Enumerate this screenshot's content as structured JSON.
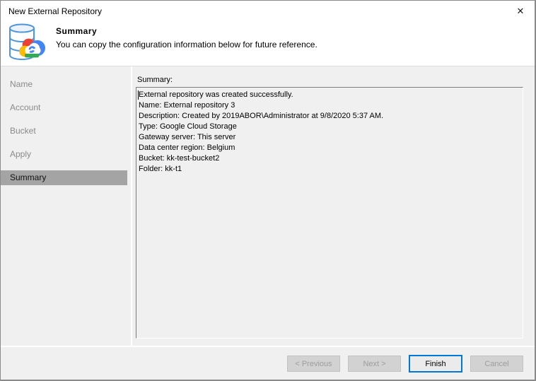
{
  "window": {
    "title": "New External Repository",
    "close_glyph": "✕"
  },
  "header": {
    "title": "Summary",
    "subtitle": "You can copy the configuration information below for future reference.",
    "icon": "database-google-cloud-icon"
  },
  "sidebar": {
    "items": [
      {
        "label": "Name",
        "active": false
      },
      {
        "label": "Account",
        "active": false
      },
      {
        "label": "Bucket",
        "active": false
      },
      {
        "label": "Apply",
        "active": false
      },
      {
        "label": "Summary",
        "active": true
      }
    ]
  },
  "main": {
    "label": "Summary:",
    "lines": [
      "External repository was created successfully.",
      "Name: External repository 3",
      "Description: Created by 2019ABOR\\Administrator at 9/8/2020 5:37 AM.",
      "Type: Google Cloud Storage",
      "Gateway server: This server",
      "Data center region: Belgium",
      "Bucket: kk-test-bucket2",
      "Folder: kk-t1"
    ]
  },
  "footer": {
    "previous_label": "< Previous",
    "next_label": "Next >",
    "finish_label": "Finish",
    "cancel_label": "Cancel"
  },
  "colors": {
    "accent": "#0078d7",
    "sidebar_active_bg": "#a4a4a4",
    "dialog_bg": "#f0f0f0",
    "gcp_red": "#ea4335",
    "gcp_yellow": "#fbbc05",
    "gcp_blue": "#4285f4",
    "gcp_green": "#34a853",
    "cylinder_stroke": "#4f94d8"
  }
}
